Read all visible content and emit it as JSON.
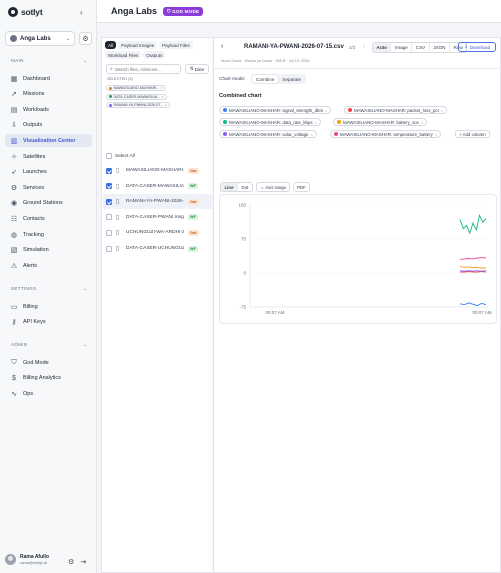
{
  "brand": {
    "name": "sotlyt",
    "logo_icon": "logo-icon"
  },
  "org": {
    "name": "Anga Labs"
  },
  "sidebar": {
    "sections": [
      {
        "title": "MAIN",
        "items": [
          {
            "label": "Dashboard",
            "icon": "grid-icon",
            "glyph": "▦",
            "active": false
          },
          {
            "label": "Missions",
            "icon": "rocket-icon",
            "glyph": "➚",
            "active": false
          },
          {
            "label": "Workloads",
            "icon": "server-icon",
            "glyph": "▤",
            "active": false
          },
          {
            "label": "Outputs",
            "icon": "download-icon",
            "glyph": "⇩",
            "active": false
          },
          {
            "label": "Visualization Center",
            "icon": "chart-icon",
            "glyph": "▥",
            "active": true
          },
          {
            "label": "Satellites",
            "icon": "satellite-icon",
            "glyph": "✧",
            "active": false
          },
          {
            "label": "Launches",
            "icon": "launch-icon",
            "glyph": "➶",
            "active": false
          },
          {
            "label": "Services",
            "icon": "services-icon",
            "glyph": "⚙",
            "active": false
          },
          {
            "label": "Ground Stations",
            "icon": "antenna-icon",
            "glyph": "◉",
            "active": false
          },
          {
            "label": "Contacts",
            "icon": "contacts-icon",
            "glyph": "☷",
            "active": false
          },
          {
            "label": "Tracking",
            "icon": "globe-icon",
            "glyph": "◍",
            "active": false
          },
          {
            "label": "Simulation",
            "icon": "simulation-icon",
            "glyph": "▧",
            "active": false
          },
          {
            "label": "Alerts",
            "icon": "alert-icon",
            "glyph": "⚠",
            "active": false
          }
        ]
      },
      {
        "title": "SETTINGS",
        "items": [
          {
            "label": "Billing",
            "icon": "card-icon",
            "glyph": "▭",
            "active": false
          },
          {
            "label": "API Keys",
            "icon": "key-icon",
            "glyph": "⚷",
            "active": false
          }
        ]
      },
      {
        "title": "ADMIN",
        "items": [
          {
            "label": "God Mode",
            "icon": "shield-icon",
            "glyph": "⛉",
            "active": false
          },
          {
            "label": "Billing Analytics",
            "icon": "dollar-icon",
            "glyph": "$",
            "active": false
          },
          {
            "label": "Ops",
            "icon": "activity-icon",
            "glyph": "∿",
            "active": false
          }
        ]
      }
    ]
  },
  "user": {
    "name": "Rama Afullo",
    "email": "rama@sotlyt.ai"
  },
  "header": {
    "title": "Anga Labs",
    "badge": "GOD MODE"
  },
  "files": {
    "tabs": [
      {
        "label": "All",
        "active": true
      },
      {
        "label": "Payload Images",
        "active": false
      },
      {
        "label": "Payload Files",
        "active": false
      },
      {
        "label": "Workload Files",
        "active": false
      },
      {
        "label": "Outputs",
        "active": false
      }
    ],
    "search_placeholder": "Search files, missions...",
    "sort_label": "Date",
    "selected_header": "SELECTED (3)",
    "selected": [
      {
        "label": "MAWASILIANO-MASHARI...",
        "color": "#e08a2c"
      },
      {
        "label": "DATA-CASER-MAWASILIA...",
        "color": "#2f9d58"
      },
      {
        "label": "RAMANI-YA-PWANI-2026-07...",
        "color": "#8b5cf6"
      }
    ],
    "select_all": "Select All",
    "items": [
      {
        "name": "MAWASILIANO-MASHARI...",
        "badge": "Out",
        "badge_type": "gps",
        "checked": true,
        "active": false
      },
      {
        "name": "DATA-CASER-MAWASILIAN...",
        "badge": "WF",
        "badge_type": "wf",
        "checked": true,
        "active": false
      },
      {
        "name": "RAMANI-YA-PWANI-2026-...",
        "badge": "Out",
        "badge_type": "gps",
        "checked": true,
        "active": true
      },
      {
        "name": "DATA-CASER-PWANI.msg",
        "badge": "WF",
        "badge_type": "wf",
        "checked": false,
        "active": false
      },
      {
        "name": "UCHUNGUZI-WA-ARDHI-2...",
        "badge": "Out",
        "badge_type": "gps",
        "checked": false,
        "active": false
      },
      {
        "name": "DATA-CASER-UCHUNGUZI...",
        "badge": "WF",
        "badge_type": "wf",
        "checked": false,
        "active": false
      }
    ]
  },
  "viewer": {
    "title": "RAMANI-YA-PWANI-2026-07-15.csv",
    "page": "2/3",
    "subtitle": "Mzuri Dunia · Macho ya Dunia · 465 B · Jul 15, 2026",
    "formats": [
      {
        "label": "Auto",
        "active": true
      },
      {
        "label": "Image",
        "active": false
      },
      {
        "label": "CSV",
        "active": false
      },
      {
        "label": "JSON",
        "active": false
      },
      {
        "label": "Raw",
        "active": false
      }
    ],
    "download": "Download",
    "chart_mode_label": "Chart mode:",
    "modes": [
      {
        "label": "Combine",
        "active": true
      },
      {
        "label": "Separate",
        "active": false
      }
    ],
    "combined_title": "Combined chart",
    "series_chips": [
      {
        "label": "MAWASILIANO-MASHAR: signal_strength_dbm",
        "color": "#3b82f6"
      },
      {
        "label": "MAWASILIANO-MASHAR: packet_loss_pct",
        "color": "#ef4444"
      },
      {
        "label": "MAWASILIANO-MASHAR: data_rate_kbps",
        "color": "#10b981"
      },
      {
        "label": "MAWASILIANO-MASHAR: battery_soc",
        "color": "#f59e0b"
      },
      {
        "label": "MAWASILIANO-MASHAR: solar_voltage",
        "color": "#8b5cf6"
      },
      {
        "label": "MAWASILIANO-MASHAR: temperature_battery",
        "color": "#ec4899"
      }
    ],
    "add_column": "+ Add column",
    "line_label": "Line",
    "dot_label": "Dot",
    "axis_range": "Axis range",
    "pdf": "PDF"
  },
  "chart_data": {
    "type": "line",
    "x_labels": [
      "00:07 AM",
      "00:07 AM"
    ],
    "ylim": [
      -75,
      150
    ],
    "yticks": [
      150,
      75,
      0,
      -75
    ],
    "ytick_labels": [
      "150",
      "75",
      "0",
      "-75"
    ],
    "series": [
      {
        "name": "MAWASILIANO-MASHAR: signal_strength_dbm",
        "color": "#3b82f6",
        "values": [
          -68,
          -70,
          -66,
          -69,
          -72,
          -67,
          -70
        ]
      },
      {
        "name": "MAWASILIANO-MASHAR: packet_loss_pct",
        "color": "#ef4444",
        "values": [
          2,
          2,
          3,
          2,
          2,
          3,
          2
        ]
      },
      {
        "name": "MAWASILIANO-MASHAR: data_rate_kbps",
        "color": "#10b981",
        "values": [
          118,
          98,
          105,
          88,
          110,
          95,
          127,
          112,
          120
        ]
      },
      {
        "name": "MAWASILIANO-MASHAR: battery_soc",
        "color": "#f59e0b",
        "values": [
          14,
          13,
          13,
          12,
          12,
          11,
          11
        ]
      },
      {
        "name": "MAWASILIANO-MASHAR: solar_voltage",
        "color": "#8b5cf6",
        "values": [
          5,
          4,
          5,
          4,
          5,
          4,
          5
        ]
      },
      {
        "name": "MAWASILIANO-MASHAR: temperature_battery",
        "color": "#ec4899",
        "values": [
          30,
          31,
          32,
          31,
          33,
          34,
          33
        ]
      }
    ]
  }
}
